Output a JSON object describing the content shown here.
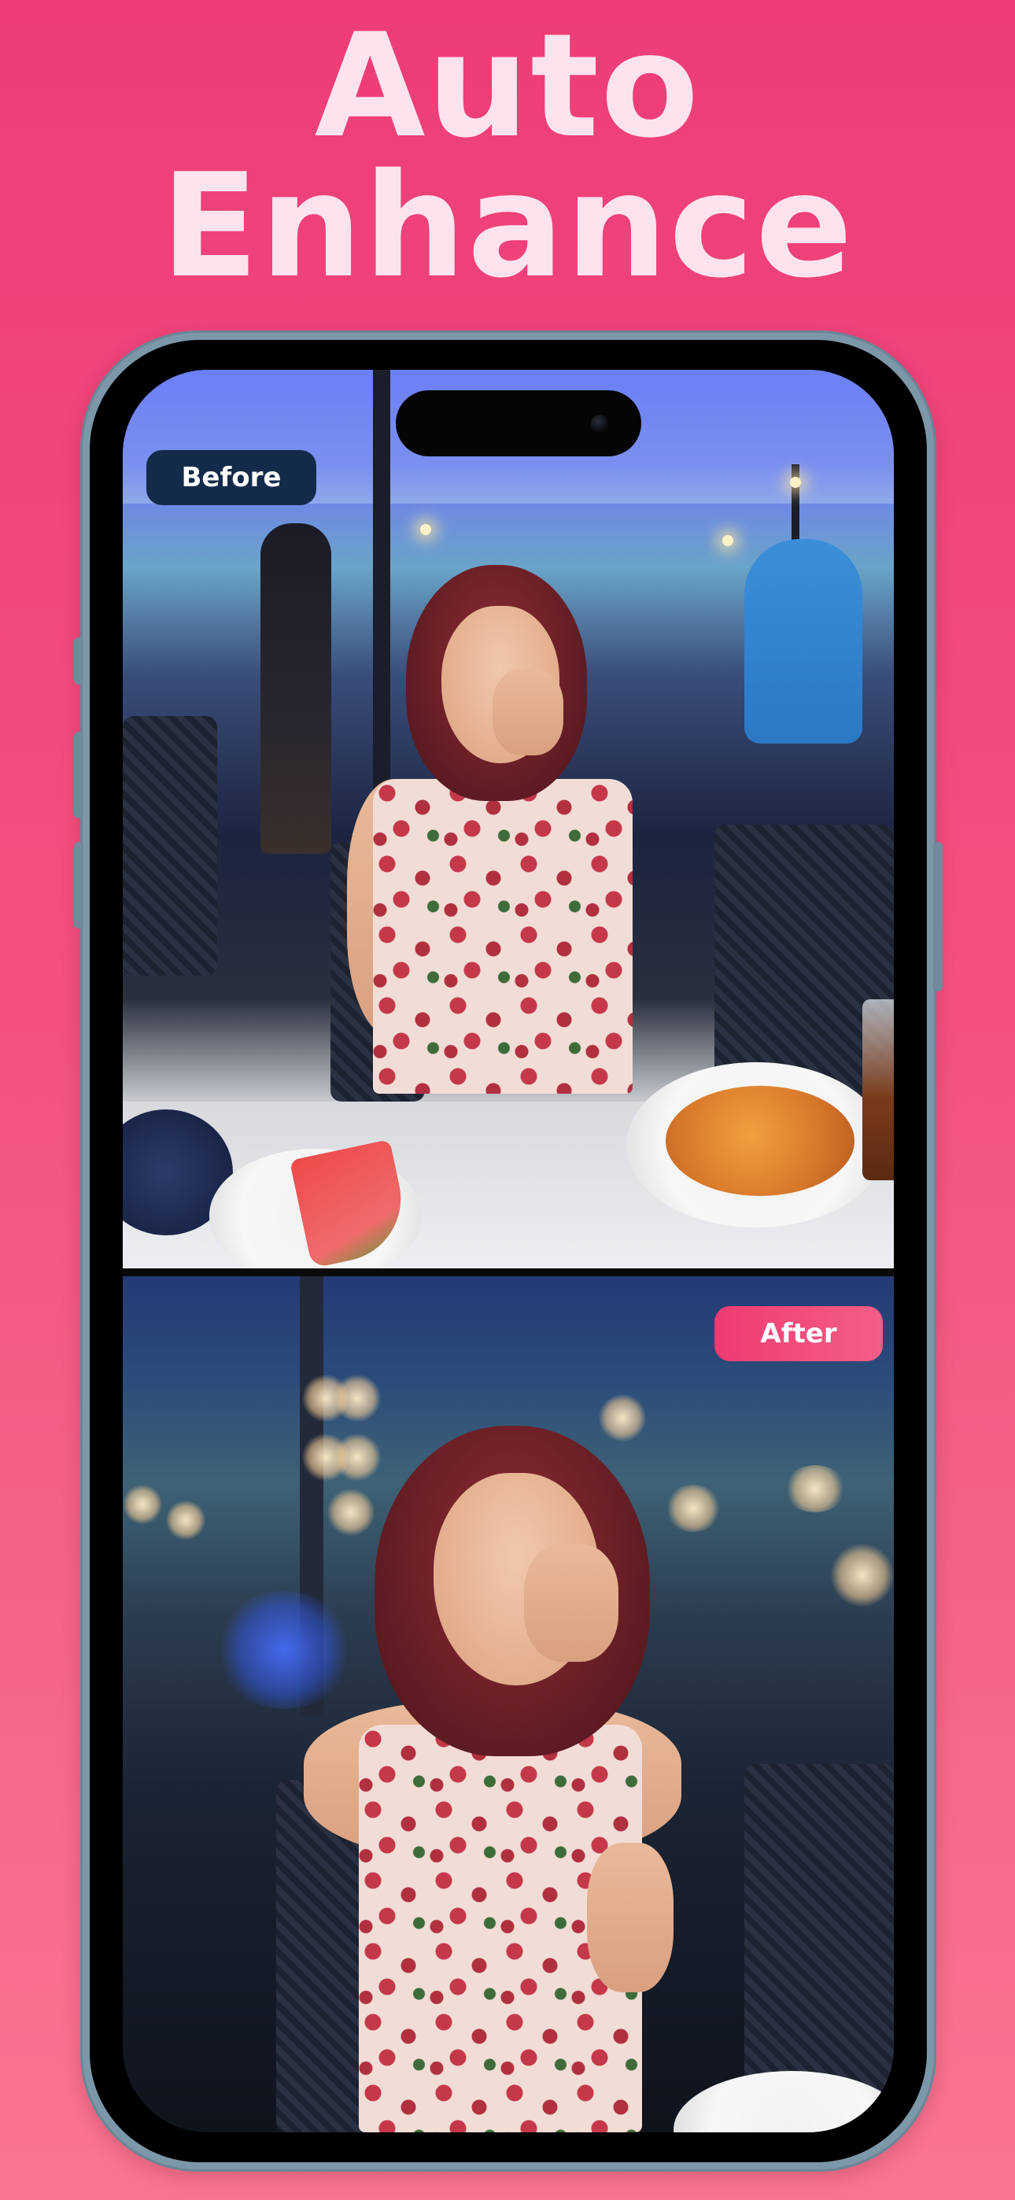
{
  "headline": {
    "line1": "Auto",
    "line2": "Enhance"
  },
  "comparison": {
    "before_label": "Before",
    "after_label": "After"
  },
  "colors": {
    "background_top": "#ee3d78",
    "background_bottom": "#f9758f",
    "headline_text": "#fde3ee",
    "before_badge": "#132a4b",
    "after_badge": "#ee3b72",
    "phone_frame": "#7c97a8"
  }
}
